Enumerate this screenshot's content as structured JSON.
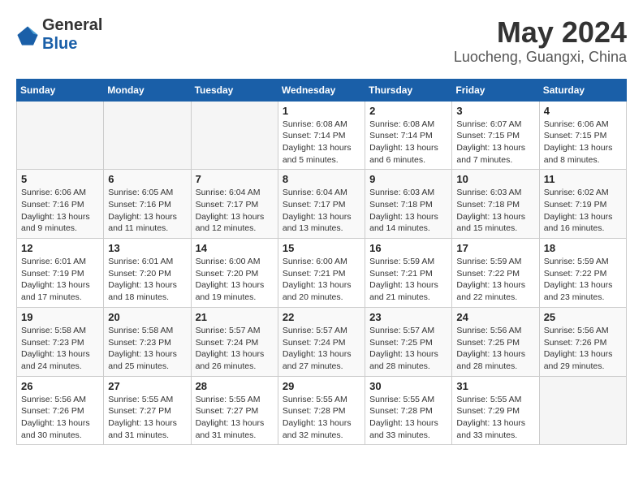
{
  "logo": {
    "general": "General",
    "blue": "Blue"
  },
  "title": "May 2024",
  "subtitle": "Luocheng, Guangxi, China",
  "weekdays": [
    "Sunday",
    "Monday",
    "Tuesday",
    "Wednesday",
    "Thursday",
    "Friday",
    "Saturday"
  ],
  "weeks": [
    [
      {
        "day": "",
        "info": ""
      },
      {
        "day": "",
        "info": ""
      },
      {
        "day": "",
        "info": ""
      },
      {
        "day": "1",
        "info": "Sunrise: 6:08 AM\nSunset: 7:14 PM\nDaylight: 13 hours\nand 5 minutes."
      },
      {
        "day": "2",
        "info": "Sunrise: 6:08 AM\nSunset: 7:14 PM\nDaylight: 13 hours\nand 6 minutes."
      },
      {
        "day": "3",
        "info": "Sunrise: 6:07 AM\nSunset: 7:15 PM\nDaylight: 13 hours\nand 7 minutes."
      },
      {
        "day": "4",
        "info": "Sunrise: 6:06 AM\nSunset: 7:15 PM\nDaylight: 13 hours\nand 8 minutes."
      }
    ],
    [
      {
        "day": "5",
        "info": "Sunrise: 6:06 AM\nSunset: 7:16 PM\nDaylight: 13 hours\nand 9 minutes."
      },
      {
        "day": "6",
        "info": "Sunrise: 6:05 AM\nSunset: 7:16 PM\nDaylight: 13 hours\nand 11 minutes."
      },
      {
        "day": "7",
        "info": "Sunrise: 6:04 AM\nSunset: 7:17 PM\nDaylight: 13 hours\nand 12 minutes."
      },
      {
        "day": "8",
        "info": "Sunrise: 6:04 AM\nSunset: 7:17 PM\nDaylight: 13 hours\nand 13 minutes."
      },
      {
        "day": "9",
        "info": "Sunrise: 6:03 AM\nSunset: 7:18 PM\nDaylight: 13 hours\nand 14 minutes."
      },
      {
        "day": "10",
        "info": "Sunrise: 6:03 AM\nSunset: 7:18 PM\nDaylight: 13 hours\nand 15 minutes."
      },
      {
        "day": "11",
        "info": "Sunrise: 6:02 AM\nSunset: 7:19 PM\nDaylight: 13 hours\nand 16 minutes."
      }
    ],
    [
      {
        "day": "12",
        "info": "Sunrise: 6:01 AM\nSunset: 7:19 PM\nDaylight: 13 hours\nand 17 minutes."
      },
      {
        "day": "13",
        "info": "Sunrise: 6:01 AM\nSunset: 7:20 PM\nDaylight: 13 hours\nand 18 minutes."
      },
      {
        "day": "14",
        "info": "Sunrise: 6:00 AM\nSunset: 7:20 PM\nDaylight: 13 hours\nand 19 minutes."
      },
      {
        "day": "15",
        "info": "Sunrise: 6:00 AM\nSunset: 7:21 PM\nDaylight: 13 hours\nand 20 minutes."
      },
      {
        "day": "16",
        "info": "Sunrise: 5:59 AM\nSunset: 7:21 PM\nDaylight: 13 hours\nand 21 minutes."
      },
      {
        "day": "17",
        "info": "Sunrise: 5:59 AM\nSunset: 7:22 PM\nDaylight: 13 hours\nand 22 minutes."
      },
      {
        "day": "18",
        "info": "Sunrise: 5:59 AM\nSunset: 7:22 PM\nDaylight: 13 hours\nand 23 minutes."
      }
    ],
    [
      {
        "day": "19",
        "info": "Sunrise: 5:58 AM\nSunset: 7:23 PM\nDaylight: 13 hours\nand 24 minutes."
      },
      {
        "day": "20",
        "info": "Sunrise: 5:58 AM\nSunset: 7:23 PM\nDaylight: 13 hours\nand 25 minutes."
      },
      {
        "day": "21",
        "info": "Sunrise: 5:57 AM\nSunset: 7:24 PM\nDaylight: 13 hours\nand 26 minutes."
      },
      {
        "day": "22",
        "info": "Sunrise: 5:57 AM\nSunset: 7:24 PM\nDaylight: 13 hours\nand 27 minutes."
      },
      {
        "day": "23",
        "info": "Sunrise: 5:57 AM\nSunset: 7:25 PM\nDaylight: 13 hours\nand 28 minutes."
      },
      {
        "day": "24",
        "info": "Sunrise: 5:56 AM\nSunset: 7:25 PM\nDaylight: 13 hours\nand 28 minutes."
      },
      {
        "day": "25",
        "info": "Sunrise: 5:56 AM\nSunset: 7:26 PM\nDaylight: 13 hours\nand 29 minutes."
      }
    ],
    [
      {
        "day": "26",
        "info": "Sunrise: 5:56 AM\nSunset: 7:26 PM\nDaylight: 13 hours\nand 30 minutes."
      },
      {
        "day": "27",
        "info": "Sunrise: 5:55 AM\nSunset: 7:27 PM\nDaylight: 13 hours\nand 31 minutes."
      },
      {
        "day": "28",
        "info": "Sunrise: 5:55 AM\nSunset: 7:27 PM\nDaylight: 13 hours\nand 31 minutes."
      },
      {
        "day": "29",
        "info": "Sunrise: 5:55 AM\nSunset: 7:28 PM\nDaylight: 13 hours\nand 32 minutes."
      },
      {
        "day": "30",
        "info": "Sunrise: 5:55 AM\nSunset: 7:28 PM\nDaylight: 13 hours\nand 33 minutes."
      },
      {
        "day": "31",
        "info": "Sunrise: 5:55 AM\nSunset: 7:29 PM\nDaylight: 13 hours\nand 33 minutes."
      },
      {
        "day": "",
        "info": ""
      }
    ]
  ]
}
